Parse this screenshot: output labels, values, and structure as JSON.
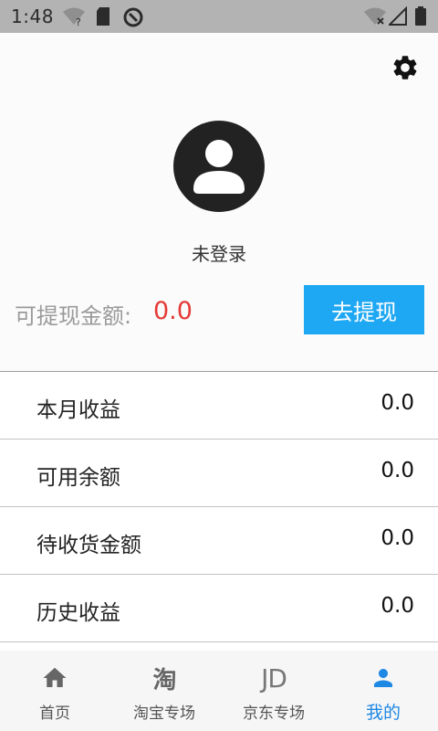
{
  "status_bar": {
    "time": "1:48"
  },
  "header": {
    "login_status": "未登录",
    "balance_label": "可提现金额:",
    "balance_value": "0.0",
    "withdraw_button": "去提现",
    "accent_color": "#1ea7f3",
    "value_color": "#e53935"
  },
  "list": {
    "items": [
      {
        "label": "本月收益",
        "value": "0.0"
      },
      {
        "label": "可用余额",
        "value": "0.0"
      },
      {
        "label": "待收货金额",
        "value": "0.0"
      },
      {
        "label": "历史收益",
        "value": "0.0"
      }
    ]
  },
  "bottom_nav": {
    "tabs": [
      {
        "label": "首页",
        "icon": "home-icon"
      },
      {
        "label": "淘宝专场",
        "icon": "taobao-icon",
        "glyph": "淘"
      },
      {
        "label": "京东专场",
        "icon": "jd-icon",
        "glyph": "JD"
      },
      {
        "label": "我的",
        "icon": "person-icon",
        "active": true
      }
    ],
    "active_color": "#1e88e5"
  }
}
